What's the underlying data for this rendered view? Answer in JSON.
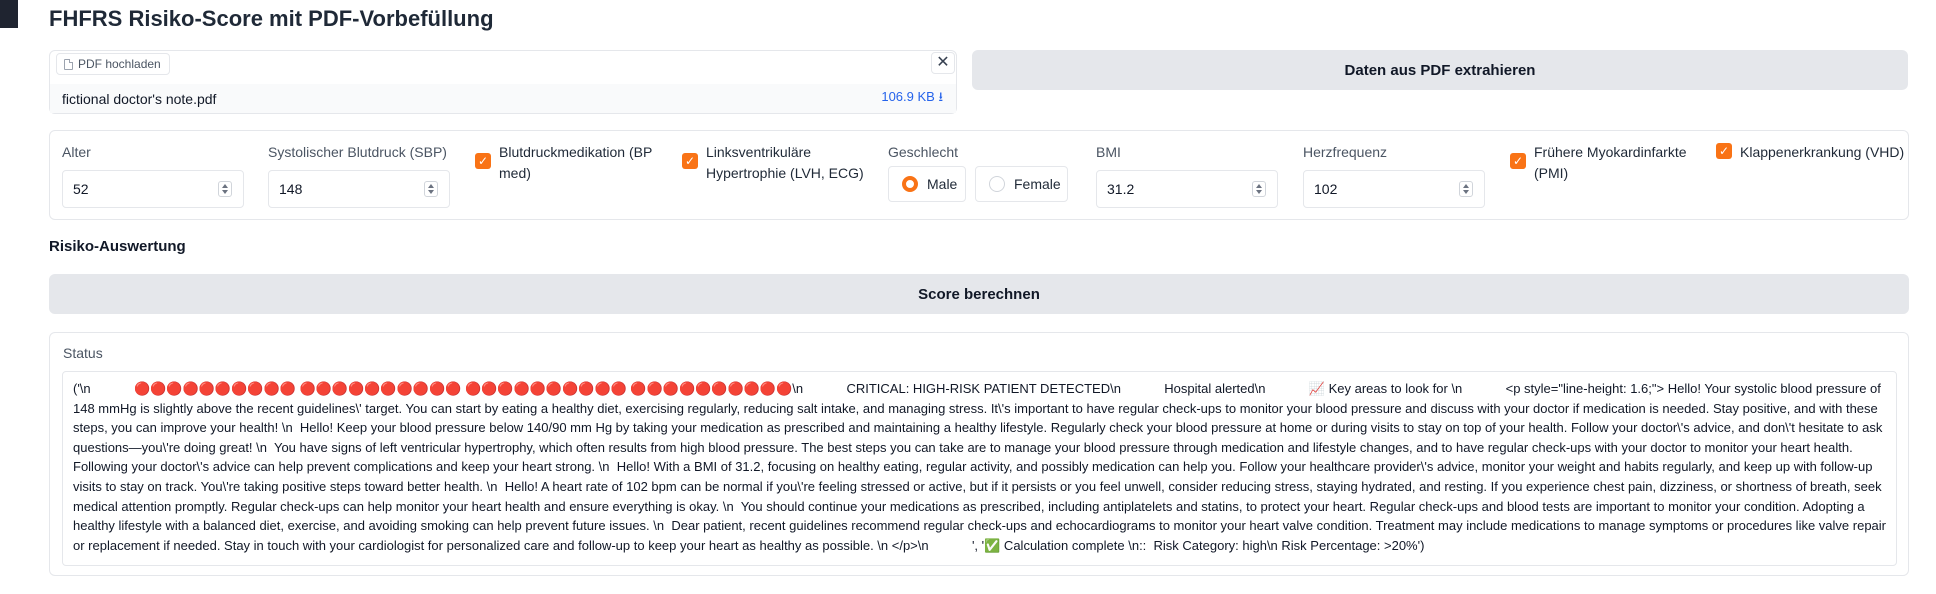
{
  "app": {
    "title": "FHFRS Risiko-Score mit PDF-Vorbefüllung"
  },
  "upload": {
    "label": "PDF hochladen",
    "file_name": "fictional doctor's note.pdf",
    "file_size": "106.9 KB ⭳",
    "close_symbol": "✕"
  },
  "actions": {
    "extract_label": "Daten aus PDF extrahieren",
    "calculate_label": "Score berechnen"
  },
  "form": {
    "age": {
      "label": "Alter",
      "value": "52"
    },
    "sbp": {
      "label": "Systolischer Blutdruck (SBP)",
      "value": "148"
    },
    "bp_med": {
      "label": "Blutdruckmedikation (BP med)",
      "checked": true
    },
    "lvh": {
      "label": "Linksventrikuläre Hypertrophie (LVH, ECG)",
      "checked": true
    },
    "sex": {
      "label": "Geschlecht",
      "options": [
        "Male",
        "Female"
      ],
      "selected": "Male"
    },
    "bmi": {
      "label": "BMI",
      "value": "31.2"
    },
    "heart_rate": {
      "label": "Herzfrequenz",
      "value": "102"
    },
    "pmi": {
      "label": "Frühere Myokardinfarkte (PMI)",
      "checked": true
    },
    "vhd": {
      "label": "Klappenerkrankung (VHD)",
      "checked": true
    }
  },
  "section": {
    "label": "Risiko-Auswertung"
  },
  "status": {
    "label": "Status",
    "text": "('\\n            🔴🔴🔴🔴🔴🔴🔴🔴🔴🔴 🔴🔴🔴🔴🔴🔴🔴🔴🔴🔴 🔴🔴🔴🔴🔴🔴🔴🔴🔴🔴 🔴🔴🔴🔴🔴🔴🔴🔴🔴🔴\\n            CRITICAL: HIGH-RISK PATIENT DETECTED\\n            Hospital alerted\\n            📈 Key areas to look for \\n            <p style=\"line-height: 1.6;\"> Hello! Your systolic blood pressure of 148 mmHg is slightly above the recent guidelines\\' target. You can start by eating a healthy diet, exercising regularly, reducing salt intake, and managing stress. It\\'s important to have regular check-ups to monitor your blood pressure and discuss with your doctor if medication is needed. Stay positive, and with these steps, you can improve your health! \\n  Hello! Keep your blood pressure below 140/90 mm Hg by taking your medication as prescribed and maintaining a healthy lifestyle. Regularly check your blood pressure at home or during visits to stay on top of your health. Follow your doctor\\'s advice, and don\\'t hesitate to ask questions—you\\'re doing great! \\n  You have signs of left ventricular hypertrophy, which often results from high blood pressure. The best steps you can take are to manage your blood pressure through medication and lifestyle changes, and to have regular check-ups with your doctor to monitor your heart health. Following your doctor\\'s advice can help prevent complications and keep your heart strong. \\n  Hello! With a BMI of 31.2, focusing on healthy eating, regular activity, and possibly medication can help you. Follow your healthcare provider\\'s advice, monitor your weight and habits regularly, and keep up with follow-up visits to stay on track. You\\'re taking positive steps toward better health. \\n  Hello! A heart rate of 102 bpm can be normal if you\\'re feeling stressed or active, but if it persists or you feel unwell, consider reducing stress, staying hydrated, and resting. If you experience chest pain, dizziness, or shortness of breath, seek medical attention promptly. Regular check-ups can help monitor your heart health and ensure everything is okay. \\n  You should continue your medications as prescribed, including antiplatelets and statins, to protect your heart. Regular check-ups and blood tests are important to monitor your condition. Adopting a healthy lifestyle with a balanced diet, exercise, and avoiding smoking can help prevent future issues. \\n  Dear patient, recent guidelines recommend regular check-ups and echocardiograms to monitor your heart valve condition. Treatment may include medications to manage symptoms or procedures like valve repair or replacement if needed. Stay in touch with your cardiologist for personalized care and follow-up to keep your heart as healthy as possible. \\n </p>\\n            ', '✅ Calculation complete \\n::  Risk Category: high\\n Risk Percentage: >20%')"
  },
  "colors": {
    "accent": "#f97316",
    "button_bg": "#e5e7eb",
    "link": "#2563eb",
    "border": "#e5e7eb"
  },
  "icons": {
    "file": "file-icon",
    "close": "close-icon",
    "download": "download-icon",
    "check": "checkmark-icon"
  }
}
